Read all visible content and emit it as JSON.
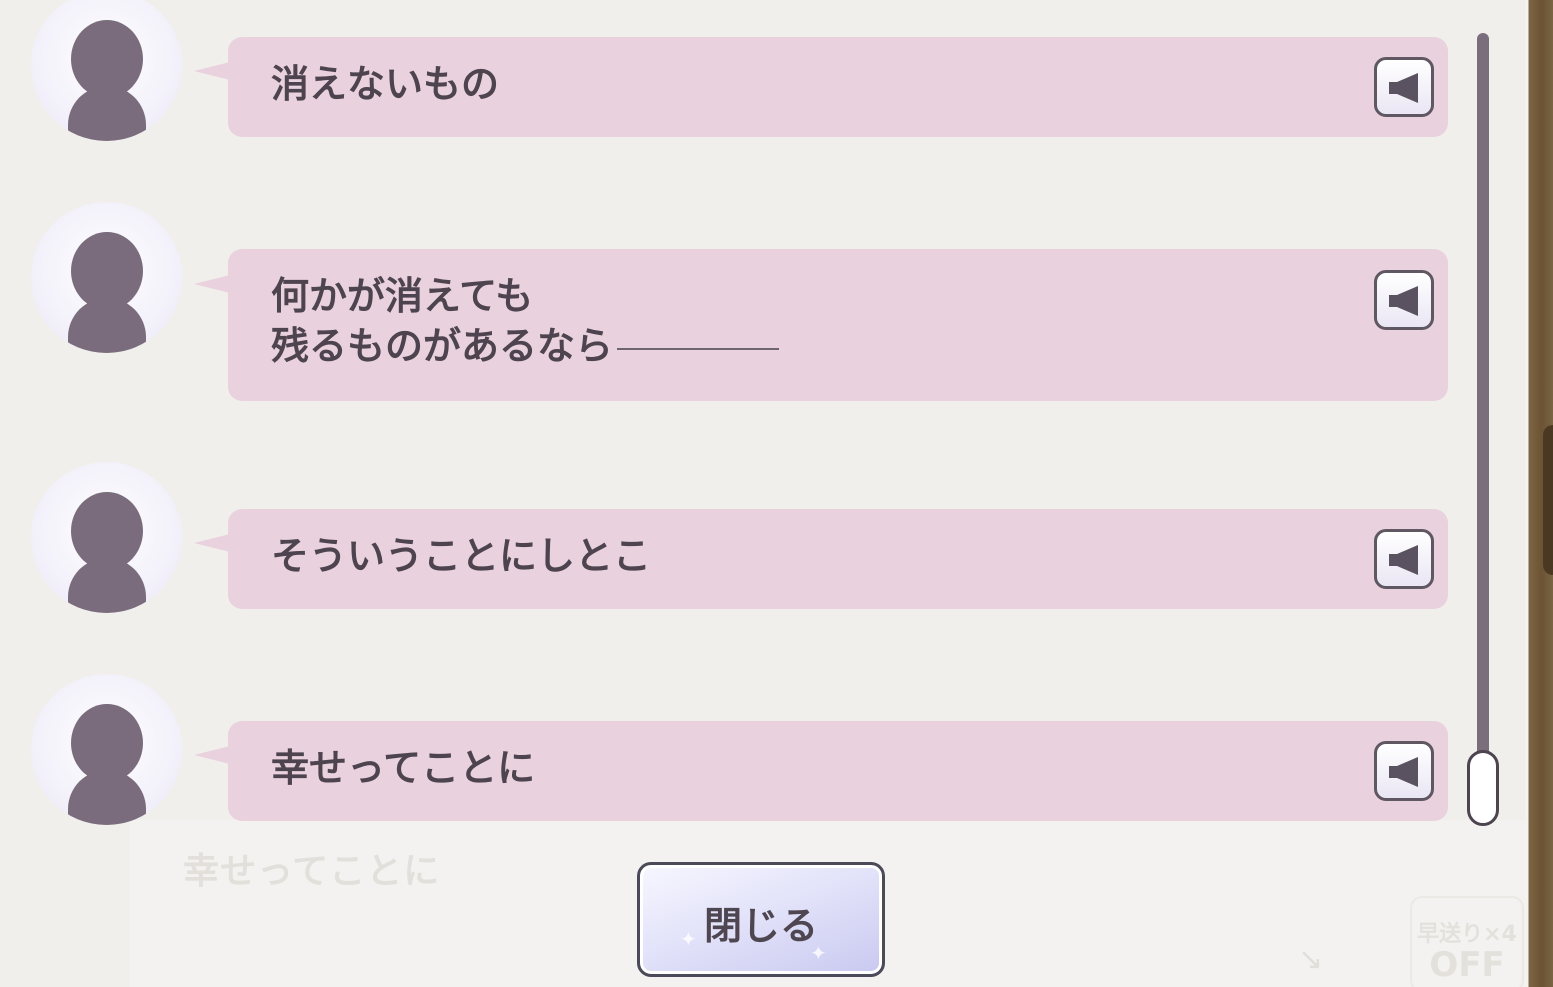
{
  "background": {
    "faded_line": "幸せってことに",
    "speed_label": "早送り×4",
    "speed_value": "OFF"
  },
  "log": {
    "entries": [
      {
        "lines": [
          "消えないもの"
        ],
        "voice_icon": "speaker-icon"
      },
      {
        "lines": [
          "何かが消えても",
          "残るものがあるなら"
        ],
        "voice_icon": "speaker-icon",
        "trailing": "dash"
      },
      {
        "lines": [
          "そういうことにしとこ"
        ],
        "voice_icon": "speaker-icon"
      },
      {
        "lines": [
          "幸せってことに"
        ],
        "voice_icon": "speaker-icon"
      }
    ],
    "scroll_position": 1.0
  },
  "close_button": {
    "label": "閉じる"
  },
  "colors": {
    "bubble": "#e9d2de",
    "text": "#4e4450",
    "avatar_silhouette": "#7a6c7c",
    "button_gradient_end": "#c9c9f0"
  }
}
